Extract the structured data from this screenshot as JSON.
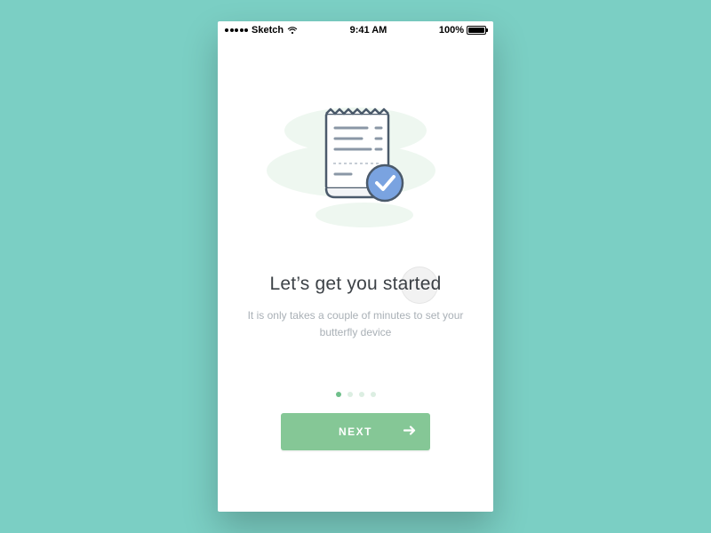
{
  "status_bar": {
    "carrier": "Sketch",
    "time": "9:41 AM",
    "battery_pct": "100%"
  },
  "onboarding": {
    "heading": "Let’s get you started",
    "subtext": "It is only takes a couple of minutes to set your butterfly device",
    "page_index": 0,
    "page_count": 4
  },
  "cta": {
    "label": "NEXT"
  },
  "colors": {
    "background": "#7bcfc4",
    "accent_green": "#85c796",
    "accent_blue": "#7aa3e0",
    "text_primary": "#3d4247",
    "text_muted": "#a9b0b6"
  },
  "icons": {
    "illustration": "receipt-check-icon",
    "cta_arrow": "arrow-right-icon",
    "wifi": "wifi-icon",
    "signal": "signal-dots-icon",
    "battery": "battery-icon"
  }
}
